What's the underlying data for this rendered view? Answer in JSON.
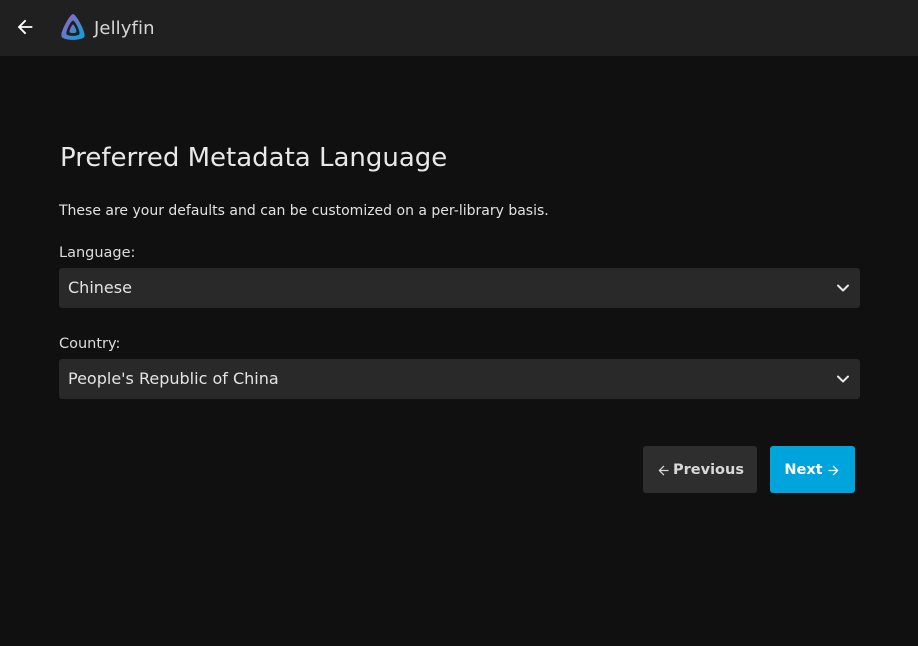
{
  "app": {
    "name": "Jellyfin",
    "accent_color": "#00a4dc"
  },
  "header": {
    "back_icon": "arrow-left-icon",
    "logo_icon": "jellyfin-logo-icon"
  },
  "page": {
    "title": "Preferred Metadata Language",
    "description": "These are your defaults and can be customized on a per-library basis."
  },
  "form": {
    "language": {
      "label": "Language:",
      "value": "Chinese"
    },
    "country": {
      "label": "Country:",
      "value": "People's Republic of China"
    }
  },
  "buttons": {
    "previous_label": "Previous",
    "next_label": "Next"
  }
}
